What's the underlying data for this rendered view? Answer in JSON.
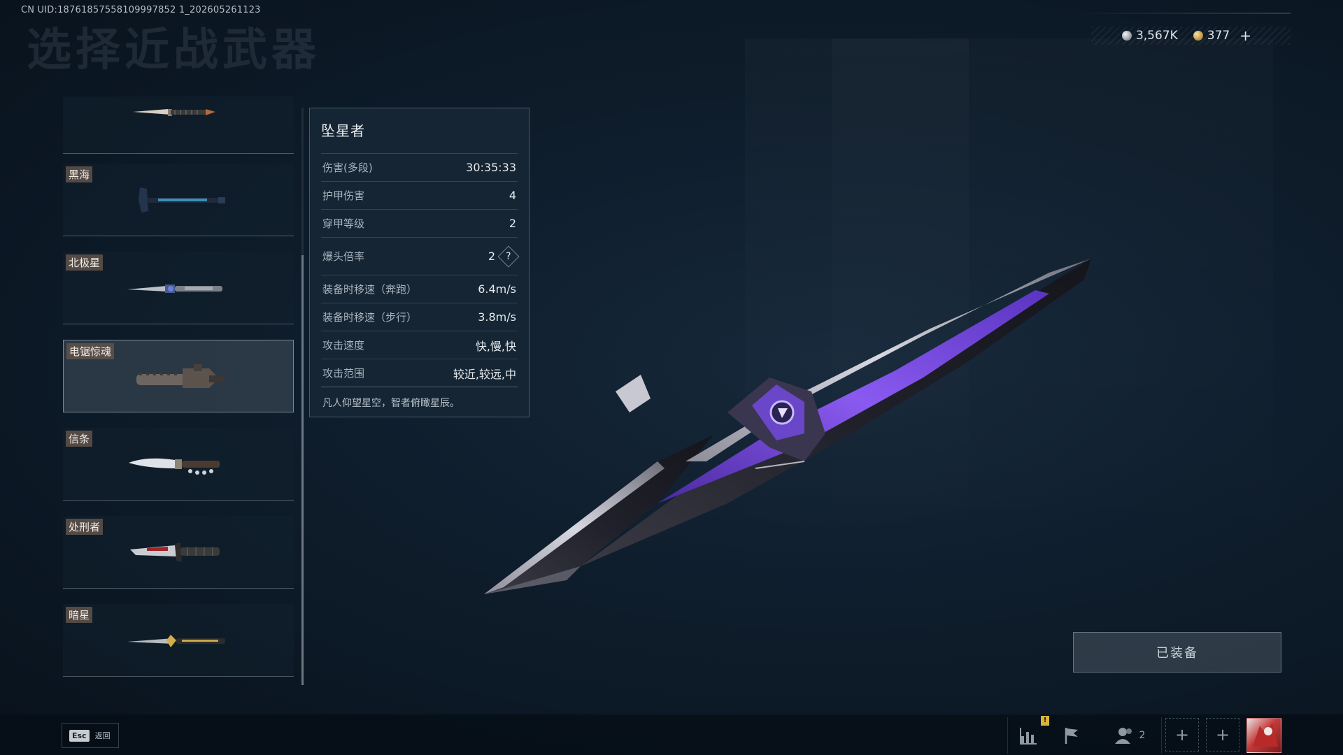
{
  "uid_text": "CN UID:18761857558109997852 1_202605261123",
  "page_title": "选择近战武器",
  "currency": {
    "silver": "3,567K",
    "gold": "377",
    "add_label": "+"
  },
  "weapons": [
    {
      "tag": ""
    },
    {
      "tag": "黑海"
    },
    {
      "tag": "北极星"
    },
    {
      "tag": "电锯惊魂"
    },
    {
      "tag": "信条"
    },
    {
      "tag": "处刑者"
    },
    {
      "tag": "暗星"
    }
  ],
  "stats": {
    "name": "坠星者",
    "rows": [
      {
        "label": "伤害(多段)",
        "value": "30:35:33"
      },
      {
        "label": "护甲伤害",
        "value": "4"
      },
      {
        "label": "穿甲等级",
        "value": "2"
      },
      {
        "label": "爆头倍率",
        "value": "2",
        "help": "?"
      },
      {
        "label": "装备时移速（奔跑）",
        "value": "6.4m/s"
      },
      {
        "label": "装备时移速（步行）",
        "value": "3.8m/s"
      },
      {
        "label": "攻击速度",
        "value": "快,慢,快"
      },
      {
        "label": "攻击范围",
        "value": "较近,较远,中"
      }
    ],
    "description": "凡人仰望星空，智者俯瞰星辰。"
  },
  "equip_button": "已装备",
  "bottom_bar": {
    "esc_key": "Esc",
    "esc_label": "返回",
    "alert_badge": "!",
    "friends_count": "2",
    "add_label": "+"
  },
  "colors": {
    "accent_purple": "#7b4fd6",
    "background": "#0f1e2d",
    "tag_background": "#60524a"
  }
}
